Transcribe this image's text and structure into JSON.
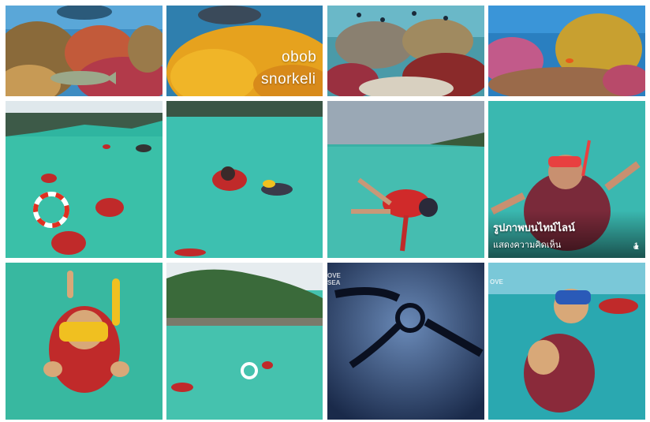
{
  "gallery": {
    "overlay_line1": "obob",
    "overlay_line2": "snorkeli",
    "timeline_title": "รูปภาพบนไทม์ไลน์",
    "timeline_subtitle": "แสดงความคิดเห็น",
    "like_count": "1",
    "watermark_line1": "OVE",
    "watermark_line2": "SEA"
  },
  "icons": {
    "like": "thumbs-up-icon"
  }
}
